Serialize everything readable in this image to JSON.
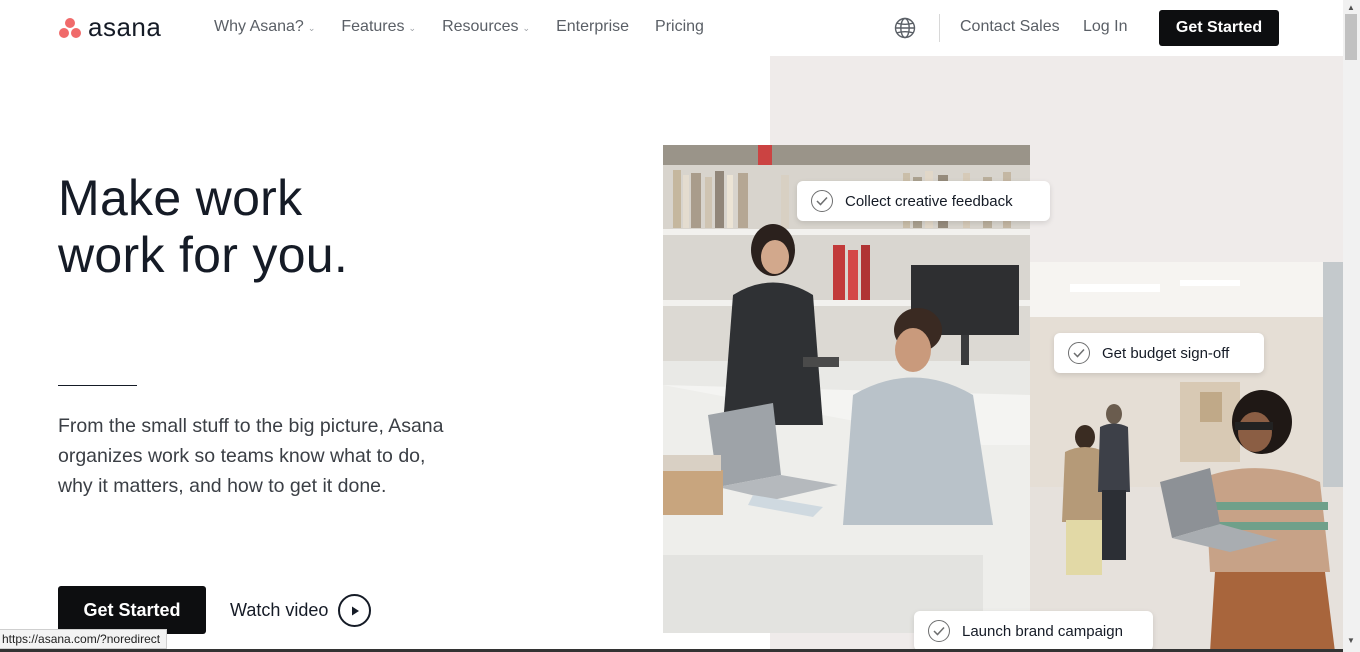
{
  "header": {
    "logo_text": "asana",
    "nav": [
      {
        "label": "Why Asana?",
        "dropdown": true
      },
      {
        "label": "Features",
        "dropdown": true
      },
      {
        "label": "Resources",
        "dropdown": true
      },
      {
        "label": "Enterprise",
        "dropdown": false
      },
      {
        "label": "Pricing",
        "dropdown": false
      }
    ],
    "globe_icon": "globe-icon",
    "contact_sales": "Contact Sales",
    "log_in": "Log In",
    "get_started": "Get Started"
  },
  "hero": {
    "title_line1": "Make work",
    "title_line2": "work for you.",
    "description": "From the small stuff to the big picture, Asana organizes work so teams know what to do, why it matters, and how to get it done.",
    "get_started": "Get Started",
    "watch_video": "Watch video"
  },
  "tasks": [
    {
      "label": "Collect creative feedback"
    },
    {
      "label": "Get budget sign-off"
    },
    {
      "label": "Launch brand campaign"
    }
  ],
  "status_bar": {
    "url": "https://asana.com/?noredirect"
  },
  "colors": {
    "brand_coral": "#f06a6a",
    "button_black": "#0d0e10",
    "panel_bg": "#efebea",
    "text_dark": "#151b26"
  }
}
